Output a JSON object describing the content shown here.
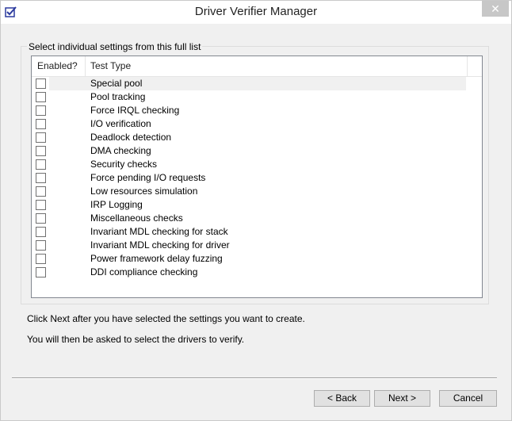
{
  "window": {
    "title": "Driver Verifier Manager",
    "close_glyph": "✕",
    "app_icon": "checkbox-app-icon"
  },
  "group": {
    "legend": "Select individual settings from this full list"
  },
  "list": {
    "columns": [
      "Enabled?",
      "Test Type"
    ],
    "items": [
      {
        "label": "Special pool",
        "checked": false
      },
      {
        "label": "Pool tracking",
        "checked": false
      },
      {
        "label": "Force IRQL checking",
        "checked": false
      },
      {
        "label": "I/O verification",
        "checked": false
      },
      {
        "label": "Deadlock detection",
        "checked": false
      },
      {
        "label": "DMA checking",
        "checked": false
      },
      {
        "label": "Security checks",
        "checked": false
      },
      {
        "label": "Force pending I/O requests",
        "checked": false
      },
      {
        "label": "Low resources simulation",
        "checked": false
      },
      {
        "label": "IRP Logging",
        "checked": false
      },
      {
        "label": "Miscellaneous checks",
        "checked": false
      },
      {
        "label": "Invariant MDL checking for stack",
        "checked": false
      },
      {
        "label": "Invariant MDL checking for driver",
        "checked": false
      },
      {
        "label": "Power framework delay fuzzing",
        "checked": false
      },
      {
        "label": "DDI compliance checking",
        "checked": false
      }
    ]
  },
  "info": {
    "line1": "Click Next after you have selected the settings you want to create.",
    "line2": "You will then be asked to select the drivers to verify."
  },
  "buttons": {
    "back": "< Back",
    "next": "Next >",
    "cancel": "Cancel"
  },
  "colors": {
    "accent_icon": "#2b3a9e",
    "close_bg": "#c7c7c7"
  }
}
